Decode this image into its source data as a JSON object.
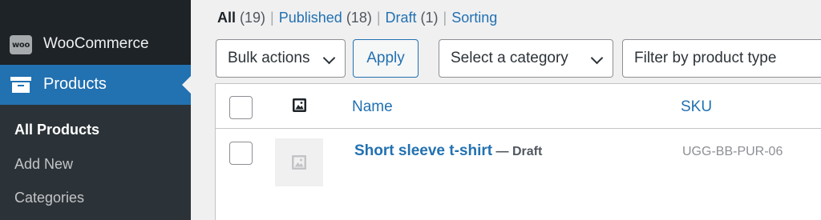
{
  "sidebar": {
    "woo_badge": "woo",
    "woo_label": "WooCommerce",
    "woo_icon": "woocommerce-icon",
    "products_label": "Products",
    "products_icon": "archive-box-icon",
    "submenu": [
      "All Products",
      "Add New",
      "Categories"
    ],
    "active_color": "#2271b1"
  },
  "filters": {
    "all": "All",
    "all_count": "(19)",
    "published": "Published",
    "published_count": "(18)",
    "draft": "Draft",
    "draft_count": "(1)",
    "sorting": "Sorting",
    "separator": "|"
  },
  "toolbar": {
    "bulk_actions": "Bulk actions",
    "apply": "Apply",
    "category": "Select a category",
    "product_type": "Filter by product type"
  },
  "table": {
    "columns": [
      "Name",
      "SKU"
    ],
    "image_column_icon": "image-icon",
    "rows": [
      {
        "name": "Short sleeve t-shirt",
        "state": " — Draft",
        "sku": "UGG-BB-PUR-06",
        "thumbnail": "placeholder-image-icon"
      }
    ]
  }
}
